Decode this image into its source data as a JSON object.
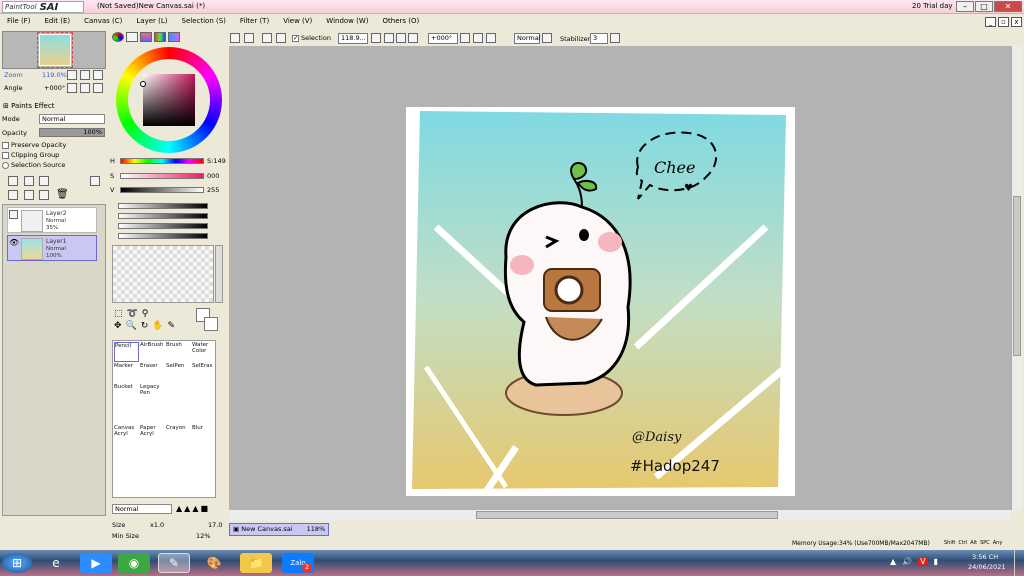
{
  "titlebar": {
    "app_small": "PaintTool",
    "app_big": "SAI",
    "document": "(Not Saved)New Canvas.sai (*)",
    "trial": "20 Trial day"
  },
  "menu": [
    "File (F)",
    "Edit (E)",
    "Canvas (C)",
    "Layer (L)",
    "Selection (S)",
    "Filter (T)",
    "View (V)",
    "Window (W)",
    "Others (O)"
  ],
  "navigator": {
    "zoom_label": "Zoom",
    "zoom_value": "119.0%",
    "angle_label": "Angle",
    "angle_value": "+000°"
  },
  "layer_props": {
    "paints_effect": "Paints Effect",
    "mode_label": "Mode",
    "mode_value": "Normal",
    "opacity_label": "Opacity",
    "opacity_value": "100%",
    "preserve_opacity": "Preserve Opacity",
    "clipping_group": "Clipping Group",
    "selection_source": "Selection Source"
  },
  "layers": [
    {
      "name": "Layer2",
      "mode": "Normal",
      "opacity": "35%"
    },
    {
      "name": "Layer1",
      "mode": "Normal",
      "opacity": "100%"
    }
  ],
  "color": {
    "h_label": "H",
    "h_value": "S:149",
    "s_label": "S",
    "s_value": "000",
    "v_label": "V",
    "v_value": "255",
    "accent": "#c2185b"
  },
  "tools": [
    {
      "name": "Pencil"
    },
    {
      "name": "AirBrush"
    },
    {
      "name": "Brush"
    },
    {
      "name": "Water Color"
    },
    {
      "name": "Marker"
    },
    {
      "name": "Eraser"
    },
    {
      "name": "SelPen"
    },
    {
      "name": "SelEras"
    },
    {
      "name": "Bucket"
    },
    {
      "name": "Legacy Pen"
    },
    {
      "name": ""
    },
    {
      "name": ""
    },
    {
      "name": "Canvas Acryl"
    },
    {
      "name": "Paper Acryl"
    },
    {
      "name": "Crayon"
    },
    {
      "name": "Blur"
    }
  ],
  "brush": {
    "mode_value": "Normal",
    "size_label": "Size",
    "size_mult": "x1.0",
    "size_value": "17.0",
    "minsize_label": "Min Size",
    "minsize_value": "12%"
  },
  "toolbar": {
    "selection_label": "Selection",
    "zoom_value": "118.9...",
    "angle_value": "+000°",
    "blend_value": "Normal",
    "stabilizer_label": "Stabilizer",
    "stabilizer_value": "3"
  },
  "artwork": {
    "bubble_text": "Chee",
    "signature": "@Daisy",
    "hashtag": "#Hadop247"
  },
  "tab": {
    "name": "New Canvas.sai",
    "zoom": "118%"
  },
  "status": {
    "memory": "Memory Usage:34% (Use700MB/Max2047MB)",
    "keys": [
      "Shift",
      "Ctrl",
      "Alt",
      "SPC",
      "Any"
    ]
  },
  "taskbar": {
    "time": "3:56 CH",
    "date": "24/06/2021",
    "zalo_badge": "2"
  }
}
